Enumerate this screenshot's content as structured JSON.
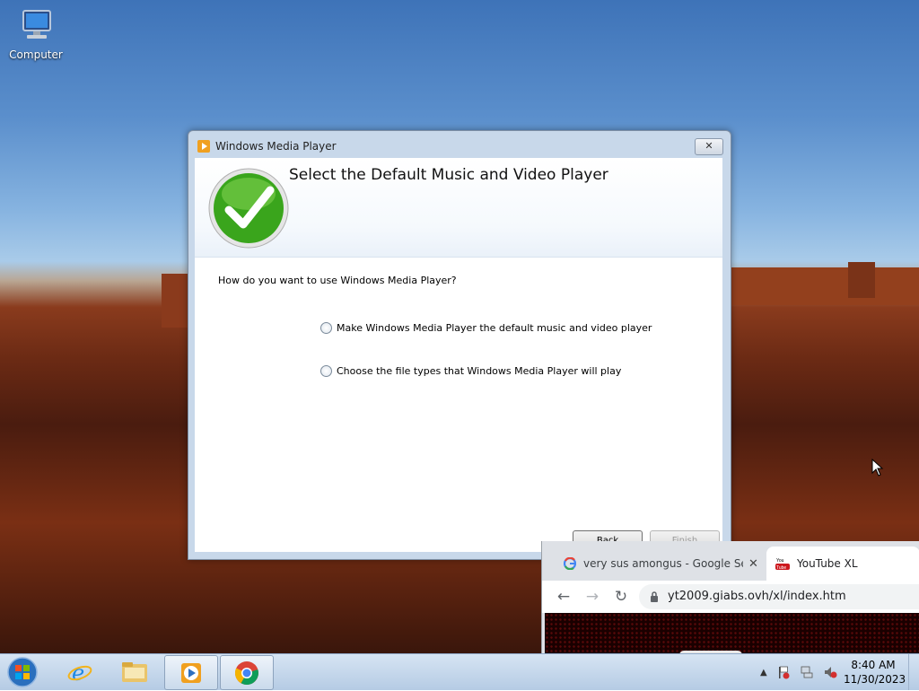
{
  "desktop": {
    "icons": [
      {
        "label": "Computer",
        "icon": "computer-icon"
      }
    ]
  },
  "dialog": {
    "title": "Windows Media Player",
    "close_glyph": "✕",
    "heading": "Select the Default Music and Video Player",
    "question": "How do you want to use Windows Media Player?",
    "options": [
      {
        "label": "Make Windows Media Player the default music and video player",
        "selected": false
      },
      {
        "label": "Choose the file types that Windows Media Player will play",
        "selected": false
      }
    ],
    "buttons": {
      "back": "Back",
      "finish": "Finish"
    }
  },
  "browser": {
    "tabs": [
      {
        "label": "very sus amongus - Google Search",
        "icon": "google-icon",
        "active": false,
        "close": "✕"
      },
      {
        "label": "YouTube XL",
        "icon": "youtube-icon",
        "active": true
      }
    ],
    "url": "yt2009.giabs.ovh/xl/index.htm"
  },
  "taskbar": {
    "items": [
      "start-button",
      "internet-explorer",
      "windows-explorer",
      "windows-media-player",
      "google-chrome"
    ],
    "clock": {
      "time": "8:40 AM",
      "date": "11/30/2023"
    },
    "tray_arrow": "▲"
  },
  "colors": {
    "accent": "#3a7bd5",
    "taskbar": "#c7d8ec",
    "check": "#3aa51c"
  }
}
